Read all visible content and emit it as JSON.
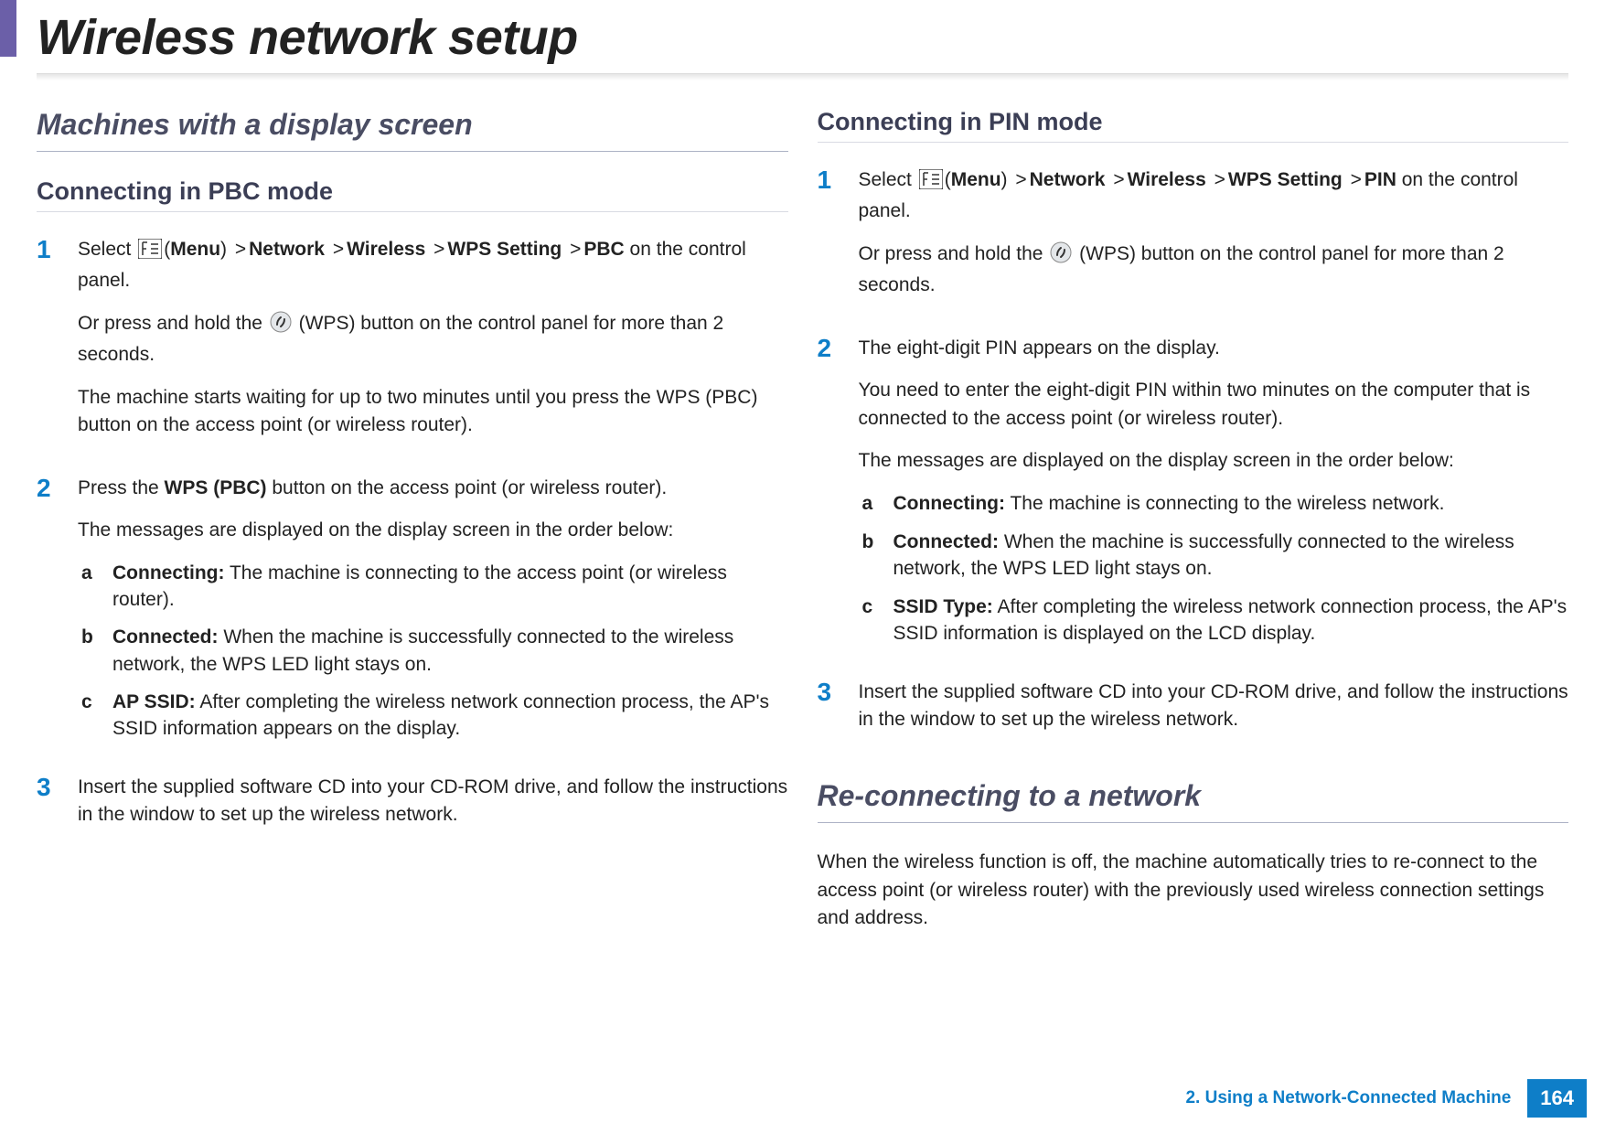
{
  "page_title": "Wireless network setup",
  "left": {
    "section_heading": "Machines with a display screen",
    "pbc": {
      "heading": "Connecting in PBC mode",
      "step1": {
        "select_pre": "Select ",
        "menu_label": "Menu",
        "bc_network": "Network",
        "bc_wireless": "Wireless",
        "bc_wps": "WPS Setting",
        "bc_pbc": "PBC",
        "select_post": " on the control panel.",
        "press_pre": "Or press and hold the ",
        "press_post": " (WPS) button on the control panel for more than 2 seconds.",
        "wait_text": "The machine starts waiting for up to two minutes until you press the WPS (PBC) button on the access point (or wireless router)."
      },
      "step2": {
        "press_pre": "Press the ",
        "wps_pbc": "WPS (PBC)",
        "press_post": " button on the access point (or wireless router).",
        "msg_intro": "The messages are displayed on the display screen in the order below:",
        "a": {
          "label": "Connecting:",
          "text": " The machine is connecting to the access point (or wireless router)."
        },
        "b": {
          "label": "Connected:",
          "text": " When the machine is successfully connected to the wireless network, the WPS LED light stays on."
        },
        "c": {
          "label": "AP SSID:",
          "text": " After completing the wireless network connection process, the AP's SSID information appears on the display."
        }
      },
      "step3": {
        "text": "Insert the supplied software CD into your CD-ROM drive, and follow the instructions in the window to set up the wireless network."
      }
    }
  },
  "right": {
    "pin": {
      "heading": "Connecting in PIN mode",
      "step1": {
        "select_pre": "Select ",
        "menu_label": "Menu",
        "bc_network": "Network",
        "bc_wireless": "Wireless",
        "bc_wps": "WPS Setting",
        "bc_pin": "PIN",
        "select_post": " on the control panel.",
        "press_pre": "Or press and hold the ",
        "press_post": " (WPS) button on the control panel for more than 2 seconds."
      },
      "step2": {
        "pin_line": "The eight-digit PIN appears on the display.",
        "enter_text": "You need to enter the eight-digit PIN within two minutes on the computer that is connected to the access point (or wireless router).",
        "msg_intro": "The messages are displayed on the display screen in the order below:",
        "a": {
          "label": "Connecting:",
          "text": " The machine is connecting to the wireless network."
        },
        "b": {
          "label": "Connected:",
          "text": " When the machine is successfully connected to the wireless network, the WPS LED light stays on."
        },
        "c": {
          "label": "SSID Type:",
          "text": " After completing the wireless network connection process, the AP's SSID information is displayed on the LCD display."
        }
      },
      "step3": {
        "text": "Insert the supplied software CD into your CD-ROM drive, and follow the instructions in the window to set up the wireless network."
      }
    },
    "reconnect": {
      "heading": "Re-connecting to a network",
      "text": "When the wireless function is off, the machine automatically tries to re-connect to the access point (or wireless router) with the previously used wireless connection settings and address."
    }
  },
  "step_labels": {
    "n1": "1",
    "n2": "2",
    "n3": "3",
    "a": "a",
    "b": "b",
    "c": "c"
  },
  "footer": {
    "chapter": "2.  Using a Network-Connected Machine",
    "page": "164"
  }
}
